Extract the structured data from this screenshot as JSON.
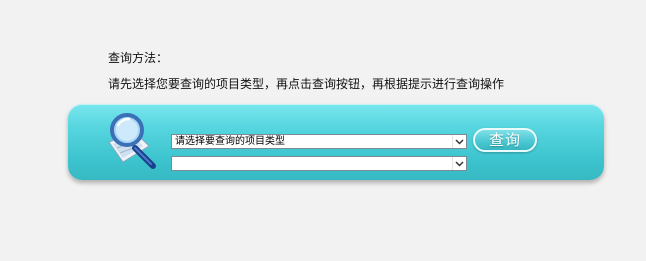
{
  "instructions": {
    "heading": "查询方法：",
    "body": "请先选择您要查询的项目类型，再点击查询按钮，再根据提示进行查询操作"
  },
  "search_panel": {
    "icon": "magnifier-document-icon",
    "project_type_select": {
      "selected": "请选择要查询的项目类型",
      "arrow_icon": "chevron-down-icon"
    },
    "sub_select": {
      "selected": "",
      "arrow_icon": "chevron-down-icon"
    },
    "query_button_label": "查询",
    "colors": {
      "panel_top": "#7ae6ee",
      "panel_bottom": "#36b9c3",
      "button_border": "#e9fbfd"
    }
  }
}
